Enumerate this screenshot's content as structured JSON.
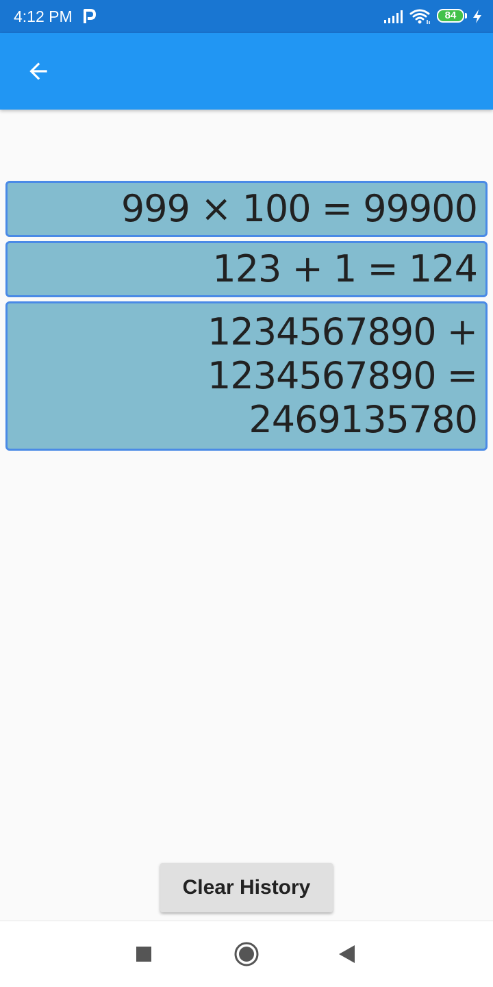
{
  "status_bar": {
    "time": "4:12 PM",
    "battery_level": "84",
    "icons": [
      "parking-icon",
      "signal-icon",
      "wifi-icon",
      "battery-icon",
      "charging-icon"
    ]
  },
  "app_bar": {
    "back_icon": "arrow-left-icon",
    "color": "#2196f3"
  },
  "history": {
    "items": [
      "999 × 100 = 99900",
      "123 + 1 = 124",
      "1234567890 + 1234567890 = 2469135780"
    ],
    "item_background": "#83bccf",
    "item_border": "#4a8ae6"
  },
  "actions": {
    "clear_label": "Clear History"
  },
  "nav_bar": {
    "icons": [
      "recent-apps-icon",
      "home-icon",
      "back-triangle-icon"
    ]
  }
}
